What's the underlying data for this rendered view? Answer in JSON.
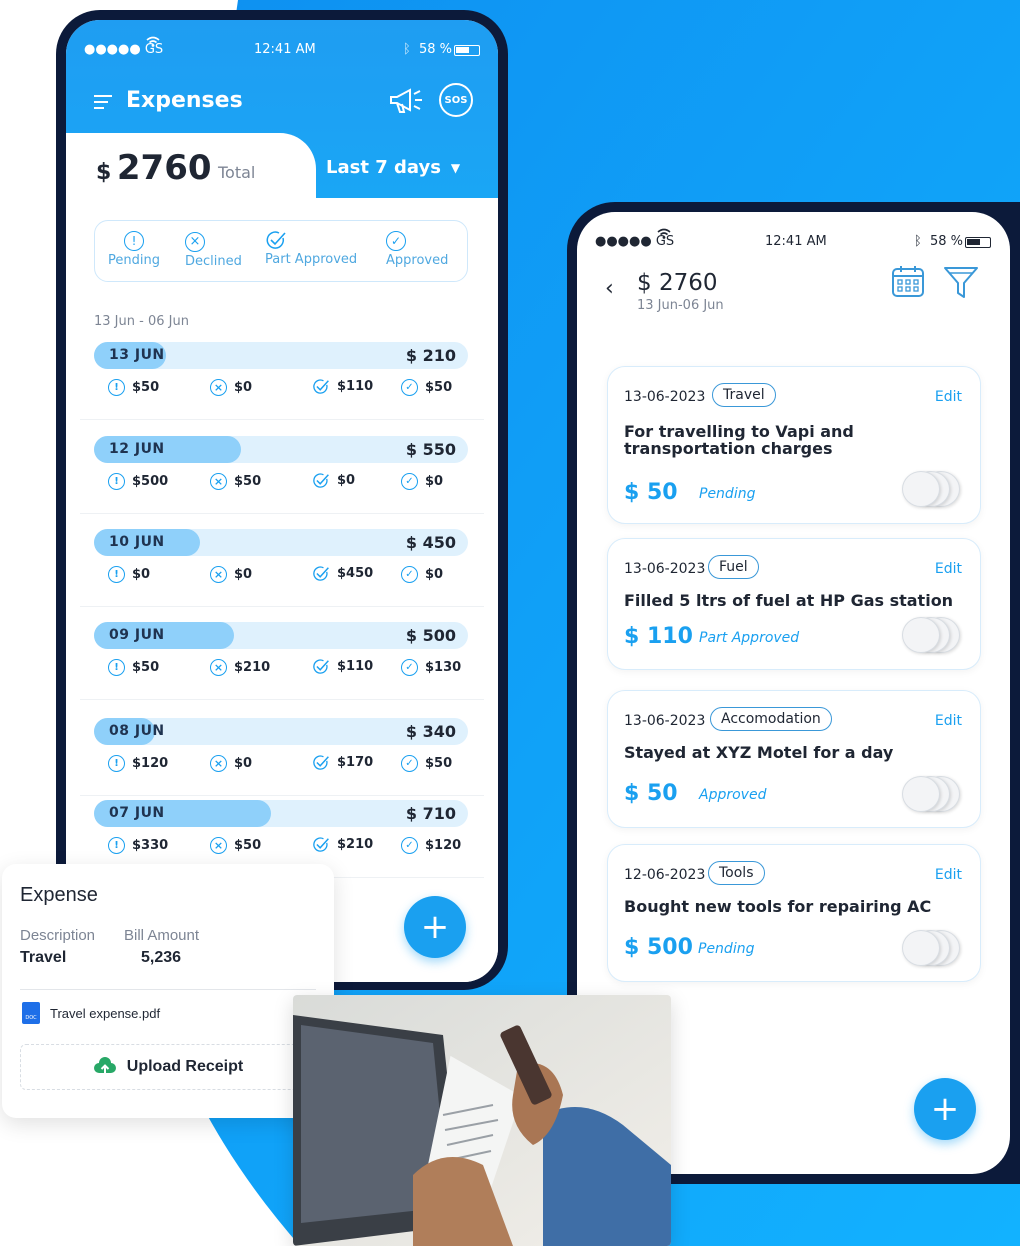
{
  "colors": {
    "accent": "#1aa0f0",
    "accent_light": "#8fd0fa",
    "bg_blue": "#0f9cf5",
    "phone_frame": "#0c1a3a"
  },
  "left_phone": {
    "status": {
      "carrier": "●●●●● GS",
      "time": "12:41 AM",
      "battery": "58 %"
    },
    "header": {
      "title": "Expenses"
    },
    "total": {
      "currency": "$",
      "amount": "2760",
      "label": "Total",
      "period": "Last 7 days"
    },
    "filters": [
      {
        "label": "Pending",
        "icon": "pending-icon"
      },
      {
        "label": "Declined",
        "icon": "declined-icon"
      },
      {
        "label": "Part Approved",
        "icon": "part-approved-icon"
      },
      {
        "label": "Approved",
        "icon": "approved-icon"
      }
    ],
    "range_label": "13 Jun - 06 Jun",
    "days": [
      {
        "label": "13 JUN",
        "total": "$ 210",
        "fill": 0.14,
        "pending": "$50",
        "declined": "$0",
        "part": "$110",
        "approved": "$50"
      },
      {
        "label": "12 JUN",
        "total": "$ 550",
        "fill": 0.34,
        "pending": "$500",
        "declined": "$50",
        "part": "$0",
        "approved": "$0"
      },
      {
        "label": "10 JUN",
        "total": "$ 450",
        "fill": 0.23,
        "pending": "$0",
        "declined": "$0",
        "part": "$450",
        "approved": "$0"
      },
      {
        "label": "09 JUN",
        "total": "$ 500",
        "fill": 0.32,
        "pending": "$50",
        "declined": "$210",
        "part": "$110",
        "approved": "$130"
      },
      {
        "label": "08 JUN",
        "total": "$ 340",
        "fill": 0.11,
        "pending": "$120",
        "declined": "$0",
        "part": "$170",
        "approved": "$50"
      },
      {
        "label": "07 JUN",
        "total": "$ 710",
        "fill": 0.42,
        "pending": "$330",
        "declined": "$50",
        "part": "$210",
        "approved": "$120"
      }
    ]
  },
  "right_phone": {
    "status": {
      "carrier": "●●●●● GS",
      "time": "12:41 AM",
      "battery": "58 %"
    },
    "header": {
      "amount": "$ 2760",
      "range": "13 Jun-06 Jun"
    },
    "cards": [
      {
        "date": "13-06-2023",
        "tag": "Travel",
        "edit": "Edit",
        "desc": "For travelling to Vapi and transportation charges",
        "amount": "$ 50",
        "status": "Pending"
      },
      {
        "date": "13-06-2023",
        "tag": "Fuel",
        "edit": "Edit",
        "desc": "Filled 5 ltrs of fuel at HP Gas station",
        "amount": "$ 110",
        "status": "Part Approved"
      },
      {
        "date": "13-06-2023",
        "tag": "Accomodation",
        "edit": "Edit",
        "desc": "Stayed at XYZ Motel for a day",
        "amount": "$ 50",
        "status": "Approved"
      },
      {
        "date": "12-06-2023",
        "tag": "Tools",
        "edit": "Edit",
        "desc": "Bought new tools for repairing AC",
        "amount": "$ 500",
        "status": "Pending"
      }
    ]
  },
  "expense_card": {
    "title": "Expense",
    "desc_label": "Description",
    "amount_label": "Bill Amount",
    "desc_value": "Travel",
    "amount_value": "5,236",
    "file_icon_text": "DOC",
    "file_name": "Travel expense.pdf",
    "upload_label": "Upload Receipt"
  }
}
